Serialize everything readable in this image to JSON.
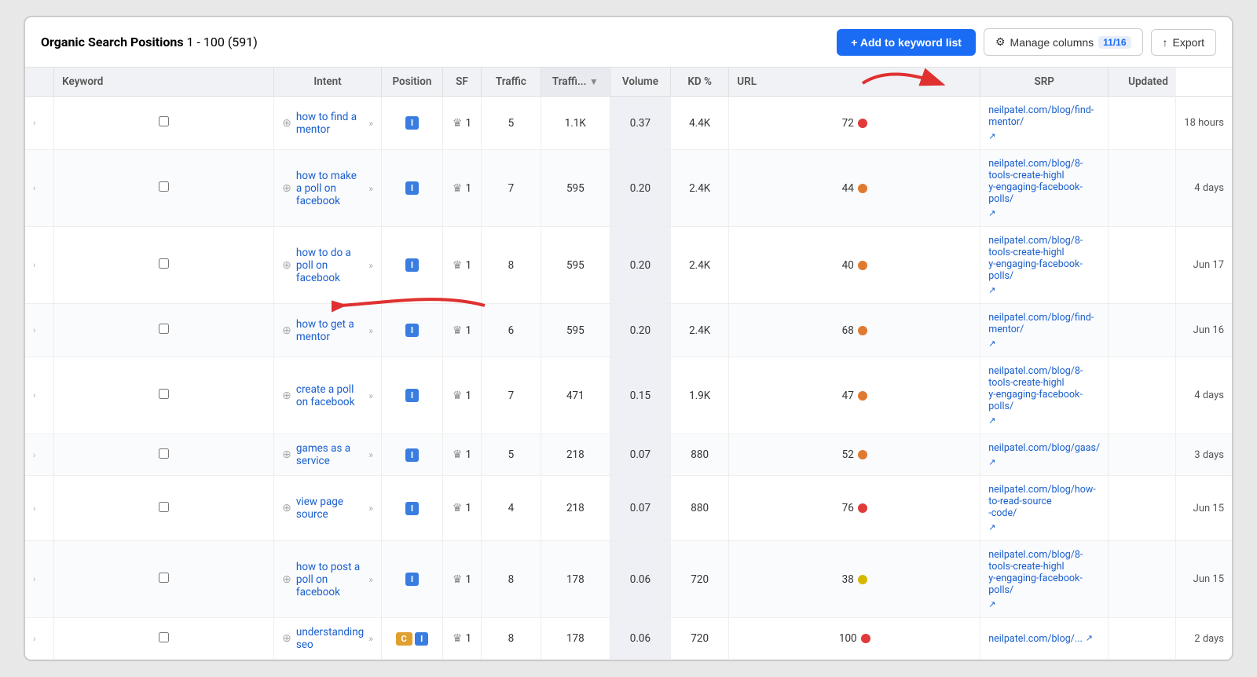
{
  "header": {
    "title": "Organic Search Positions",
    "range": "1 - 100 (591)",
    "btn_add": "+ Add to keyword list",
    "btn_manage": "Manage columns",
    "manage_badge": "11/16",
    "btn_export": "Export"
  },
  "columns": [
    "",
    "Keyword",
    "Intent",
    "Position",
    "SF",
    "Traffic",
    "Traffi...",
    "Volume",
    "KD %",
    "URL",
    "SRP",
    "Updated"
  ],
  "rows": [
    {
      "keyword": "how to find a mentor",
      "intent": "I",
      "position": "1",
      "sf": "5",
      "traffic": "1.1K",
      "traffic2": "0.37",
      "volume": "4.4K",
      "kd": "72",
      "kd_color": "red",
      "url": "neilpatel.com/blog/find-mentor/",
      "updated": "18 hours"
    },
    {
      "keyword": "how to make a poll on facebook",
      "intent": "I",
      "position": "1",
      "sf": "7",
      "traffic": "595",
      "traffic2": "0.20",
      "volume": "2.4K",
      "kd": "44",
      "kd_color": "orange",
      "url": "neilpatel.com/blog/8-tools-create-highly-engaging-facebook-polls/",
      "updated": "4 days"
    },
    {
      "keyword": "how to do a poll on facebook",
      "intent": "I",
      "position": "1",
      "sf": "8",
      "traffic": "595",
      "traffic2": "0.20",
      "volume": "2.4K",
      "kd": "40",
      "kd_color": "orange",
      "url": "neilpatel.com/blog/8-tools-create-highly-engaging-facebook-polls/",
      "updated": "Jun 17"
    },
    {
      "keyword": "how to get a mentor",
      "intent": "I",
      "position": "1",
      "sf": "6",
      "traffic": "595",
      "traffic2": "0.20",
      "volume": "2.4K",
      "kd": "68",
      "kd_color": "orange",
      "url": "neilpatel.com/blog/find-mentor/",
      "updated": "Jun 16"
    },
    {
      "keyword": "create a poll on facebook",
      "intent": "I",
      "position": "1",
      "sf": "7",
      "traffic": "471",
      "traffic2": "0.15",
      "volume": "1.9K",
      "kd": "47",
      "kd_color": "orange",
      "url": "neilpatel.com/blog/8-tools-create-highly-engaging-facebook-polls/",
      "updated": "4 days"
    },
    {
      "keyword": "games as a service",
      "intent": "I",
      "position": "1",
      "sf": "5",
      "traffic": "218",
      "traffic2": "0.07",
      "volume": "880",
      "kd": "52",
      "kd_color": "orange",
      "url": "neilpatel.com/blog/gaas/",
      "updated": "3 days"
    },
    {
      "keyword": "view page source",
      "intent": "I",
      "position": "1",
      "sf": "4",
      "traffic": "218",
      "traffic2": "0.07",
      "volume": "880",
      "kd": "76",
      "kd_color": "red",
      "url": "neilpatel.com/blog/how-to-read-source-code/",
      "updated": "Jun 15"
    },
    {
      "keyword": "how to post a poll on facebook",
      "intent": "I",
      "position": "1",
      "sf": "8",
      "traffic": "178",
      "traffic2": "0.06",
      "volume": "720",
      "kd": "38",
      "kd_color": "orange",
      "url": "neilpatel.com/blog/8-tools-create-highly-engaging-facebook-polls/",
      "updated": "Jun 15"
    },
    {
      "keyword": "understanding seo",
      "intent": "CI",
      "position": "1",
      "sf": "8",
      "traffic": "178",
      "traffic2": "0.06",
      "volume": "720",
      "kd": "100",
      "kd_color": "red",
      "url": "neilpatel.com/blog/...",
      "updated": "2 days"
    }
  ]
}
